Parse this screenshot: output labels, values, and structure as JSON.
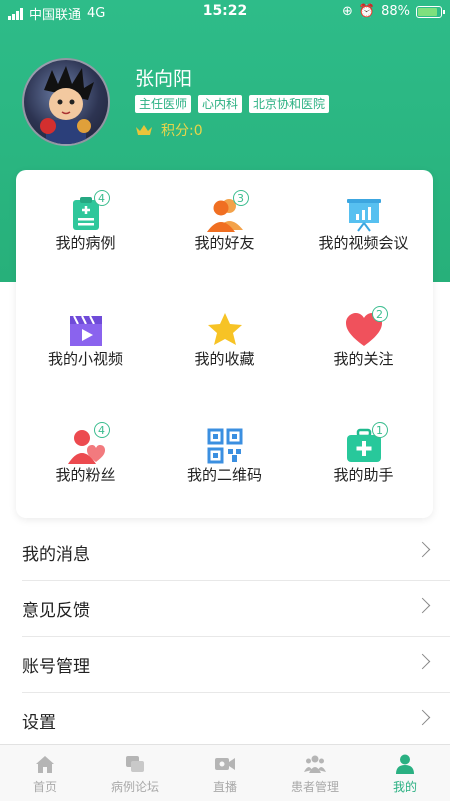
{
  "status_bar": {
    "carrier": "中国联通",
    "network": "4G",
    "time": "15:22",
    "battery": "88%",
    "battery_level": 0.88
  },
  "profile": {
    "name": "张向阳",
    "tags": [
      "主任医师",
      "心内科",
      "北京协和医院"
    ],
    "points": "积分:0"
  },
  "grid": [
    {
      "label": "我的病例",
      "badge": "4",
      "icon": "clipboard-icon"
    },
    {
      "label": "我的好友",
      "badge": "3",
      "icon": "friends-icon"
    },
    {
      "label": "我的视频会议",
      "badge": "",
      "icon": "presentation-icon"
    },
    {
      "label": "我的小视频",
      "badge": "",
      "icon": "video-clip-icon"
    },
    {
      "label": "我的收藏",
      "badge": "",
      "icon": "star-icon"
    },
    {
      "label": "我的关注",
      "badge": "2",
      "icon": "heart-icon"
    },
    {
      "label": "我的粉丝",
      "badge": "4",
      "icon": "fans-icon"
    },
    {
      "label": "我的二维码",
      "badge": "",
      "icon": "qr-code-icon"
    },
    {
      "label": "我的助手",
      "badge": "1",
      "icon": "medical-kit-icon"
    }
  ],
  "menu": [
    "我的消息",
    "意见反馈",
    "账号管理",
    "设置"
  ],
  "tabs": [
    {
      "label": "首页",
      "icon": "home-icon"
    },
    {
      "label": "病例论坛",
      "icon": "forum-icon"
    },
    {
      "label": "直播",
      "icon": "live-camera-icon"
    },
    {
      "label": "患者管理",
      "icon": "patients-icon"
    },
    {
      "label": "我的",
      "icon": "profile-icon"
    }
  ],
  "colors": {
    "brand": "#2ab082",
    "badge": "#3bbd8f",
    "star": "#f7c325",
    "heart": "#f0515c"
  }
}
